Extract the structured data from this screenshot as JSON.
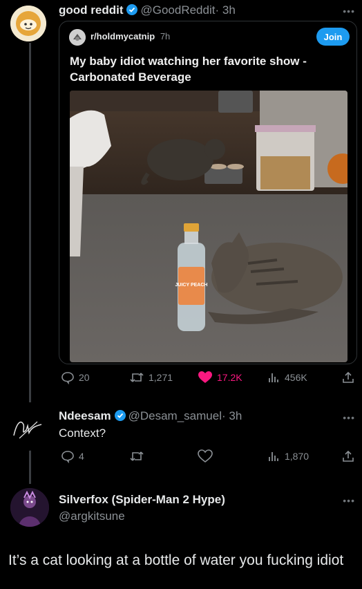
{
  "post": {
    "author_name": "good reddit",
    "author_handle": "@GoodReddit",
    "time": "· 3h",
    "quote": {
      "subreddit": "r/holdmycatnip",
      "time": "7h",
      "join_label": "Join",
      "title": "My baby idiot watching her favorite show - Carbonated Beverage",
      "bottle_label": "JUICY PEACH"
    },
    "stats": {
      "replies": "20",
      "reposts": "1,271",
      "likes": "17.2K",
      "views": "456K"
    }
  },
  "reply1": {
    "author_name": "Ndeesam",
    "author_handle": "@Desam_samuel",
    "time": "· 3h",
    "text": "Context?",
    "stats": {
      "replies": "4",
      "views": "1,870"
    }
  },
  "reply2": {
    "author_name": "Silverfox (Spider-Man 2 Hype)",
    "author_handle": "@argkitsune",
    "text": "It’s a cat looking at a bottle of water you fucking idiot"
  },
  "colors": {
    "accent": "#1d9bf0",
    "like": "#f91880",
    "muted": "#8b9095"
  },
  "icons": [
    "reply-icon",
    "repost-icon",
    "like-icon",
    "views-icon",
    "share-icon",
    "verified-icon",
    "more-icon"
  ]
}
